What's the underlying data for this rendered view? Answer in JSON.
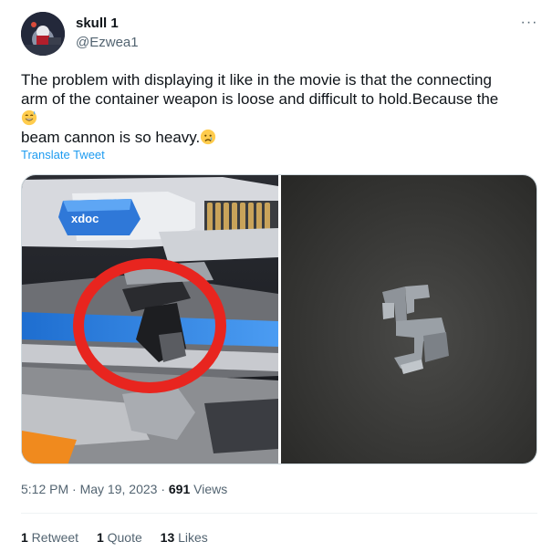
{
  "user": {
    "display_name": "skull 1",
    "handle": "@Ezwea1"
  },
  "tweet": {
    "text_lines": [
      "The problem with displaying it like in the movie is that the connecting",
      "arm of the container weapon is loose and difficult to hold.Because the",
      "",
      "beam cannon is so heavy."
    ],
    "emoji": [
      "grinning-face-with-sweat",
      "crying-face"
    ],
    "translate_label": "Translate Tweet",
    "model_label_text": "xdoc"
  },
  "meta": {
    "time": "5:12 PM",
    "separator": " · ",
    "date": "May 19, 2023",
    "views_count": "691",
    "views_label": " Views"
  },
  "stats": {
    "retweets_count": "1",
    "retweets_label": " Retweet",
    "quotes_count": "1",
    "quotes_label": " Quote",
    "likes_count": "13",
    "likes_label": " Likes"
  },
  "colors": {
    "link": "#1d9bf0",
    "secondary_text": "#536471",
    "highlight_circle": "#e8251f"
  }
}
